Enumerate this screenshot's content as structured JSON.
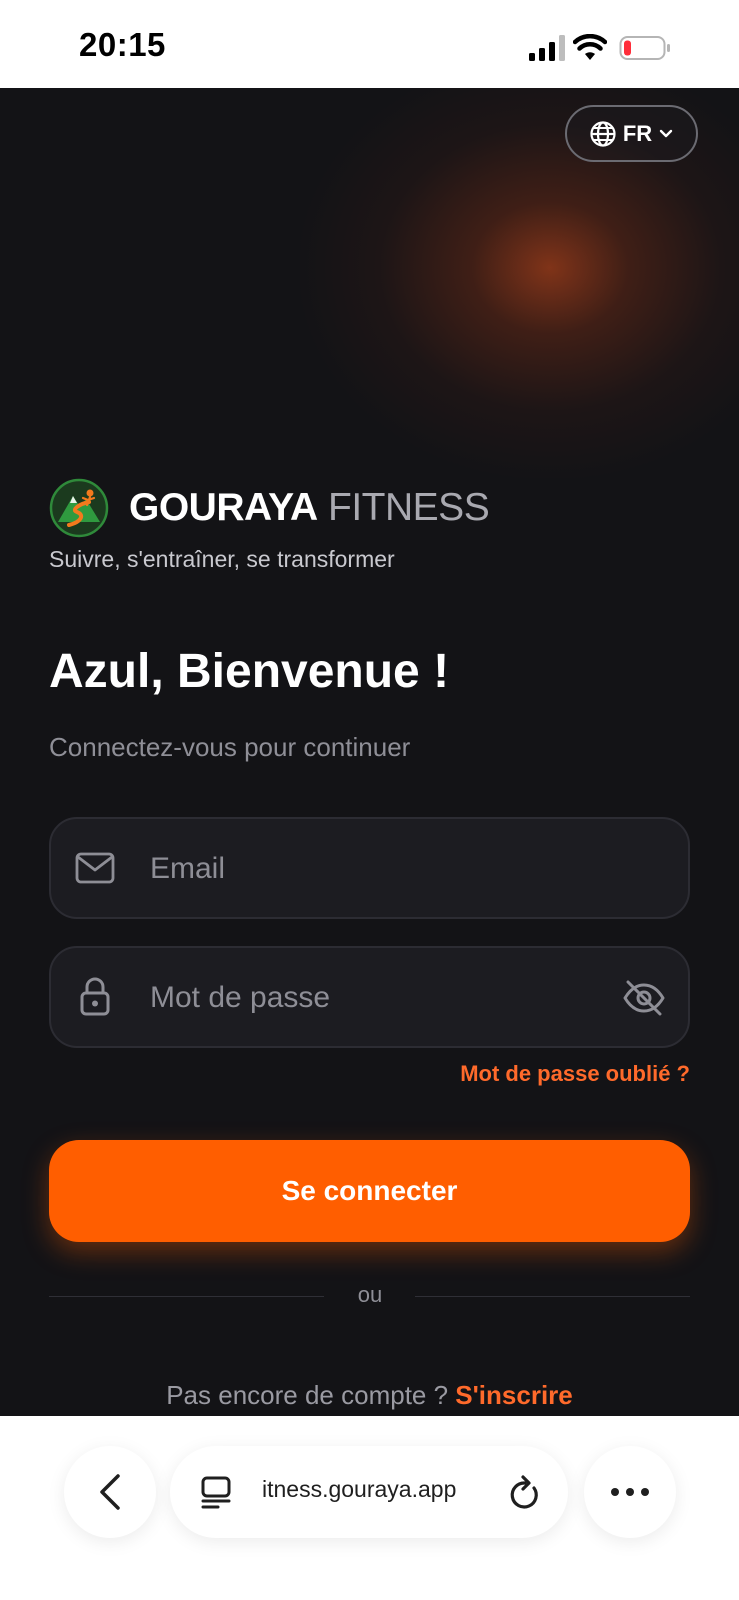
{
  "status_bar": {
    "time": "20:15",
    "icons": [
      "signal-icon",
      "wifi-icon",
      "battery-icon"
    ]
  },
  "language": {
    "label": "FR",
    "icons": [
      "globe-icon",
      "chevron-down-icon"
    ]
  },
  "brand": {
    "name_strong": "GOURAYA",
    "name_light": " FITNESS",
    "tagline": "Suivre, s'entraîner, se transformer"
  },
  "welcome": {
    "title": "Azul, Bienvenue !",
    "subtitle": "Connectez-vous pour continuer"
  },
  "form": {
    "email_placeholder": "Email",
    "password_placeholder": "Mot de passe",
    "forgot_label": "Mot de passe oublié ?",
    "submit_label": "Se connecter",
    "divider_label": "ou",
    "signup_prompt": "Pas encore de compte ? ",
    "signup_link": "S'inscrire"
  },
  "browser": {
    "url": "itness.gouraya.app"
  },
  "colors": {
    "accent": "#ff5e00",
    "link": "#ff6a2b",
    "background": "#131316",
    "field": "#1c1c21"
  }
}
